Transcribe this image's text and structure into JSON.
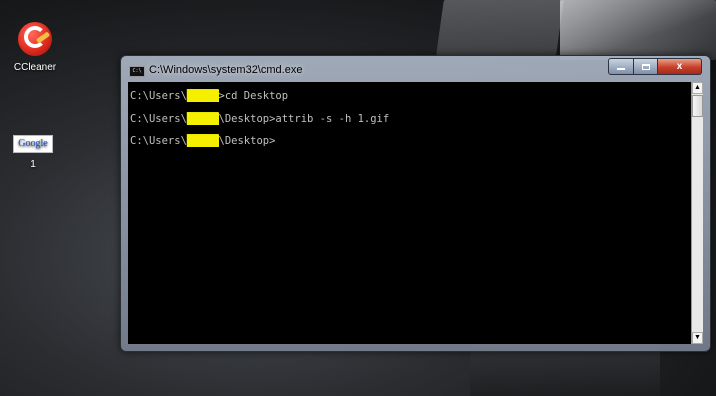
{
  "desktop": {
    "icons": [
      {
        "label": "CCleaner",
        "icon": "ccleaner-icon"
      },
      {
        "label": "1",
        "icon": "google-icon",
        "image_text": "Google"
      }
    ]
  },
  "window": {
    "title": "C:\\Windows\\system32\\cmd.exe",
    "app_icon_text": "C:\\",
    "controls": {
      "minimize": "minimize",
      "maximize": "maximize",
      "close": "x"
    }
  },
  "console": {
    "lines": [
      {
        "prefix": "C:\\Users\\",
        "redacted": "█████",
        "suffix": ">cd Desktop"
      },
      {
        "prefix": "C:\\Users\\",
        "redacted": "█████",
        "suffix": "\\Desktop>attrib -s -h 1.gif"
      },
      {
        "prefix": "C:\\Users\\",
        "redacted": "█████",
        "suffix": "\\Desktop>"
      }
    ],
    "redaction_color": "#f5f000",
    "text_color": "#c0c0c0",
    "background": "#000000"
  },
  "scrollbar": {
    "up": "▲",
    "down": "▼"
  }
}
